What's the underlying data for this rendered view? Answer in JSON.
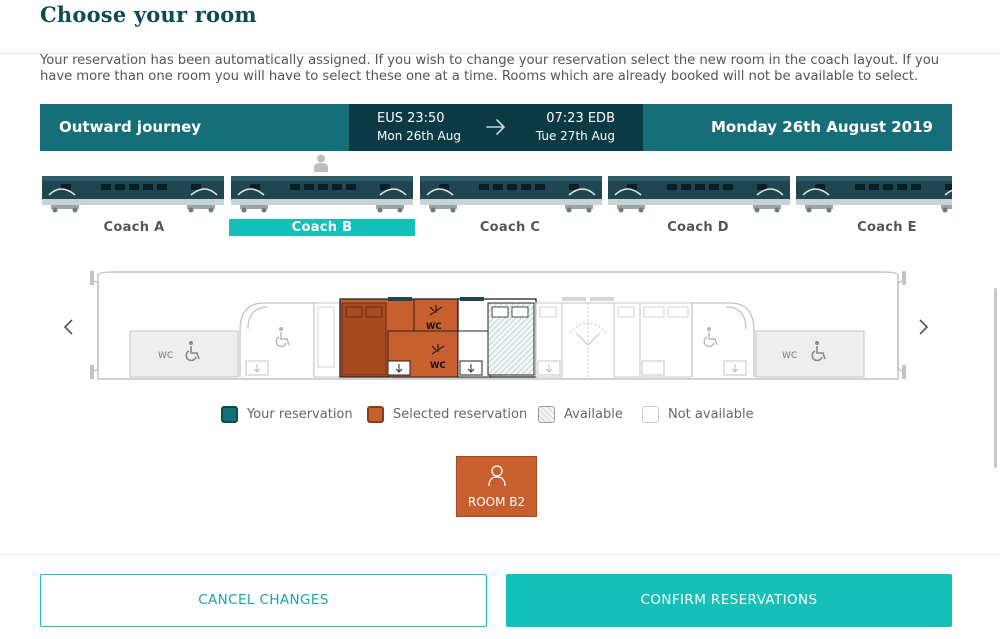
{
  "page": {
    "title": "Choose your room",
    "intro": "Your reservation has been automatically assigned. If you wish to change your reservation select the new room in the coach layout. If you have more than one room you will have to select these one at a time. Rooms which are already booked will not be available to select."
  },
  "journey": {
    "label": "Outward journey",
    "departure_station": "EUS 23:50",
    "departure_date": "Mon 26th Aug",
    "arrival_station": "07:23 EDB",
    "arrival_date": "Tue 27th Aug",
    "date": "Monday 26th August 2019"
  },
  "coaches": [
    {
      "label": "Coach A",
      "selected": false
    },
    {
      "label": "Coach B",
      "selected": true
    },
    {
      "label": "Coach C",
      "selected": false
    },
    {
      "label": "Coach D",
      "selected": false
    },
    {
      "label": "Coach E",
      "selected": false
    }
  ],
  "layout": {
    "wc_label": "WC"
  },
  "legend": {
    "your_reservation": "Your reservation",
    "selected_reservation": "Selected reservation",
    "available": "Available",
    "not_available": "Not available"
  },
  "selected_room": {
    "label": "ROOM B2"
  },
  "buttons": {
    "cancel": "CANCEL CHANGES",
    "confirm": "CONFIRM RESERVATIONS"
  },
  "colors": {
    "brand_teal": "#166e78",
    "brand_dark": "#0b3a45",
    "accent": "#14c0b8",
    "selected": "#c85f2e"
  }
}
